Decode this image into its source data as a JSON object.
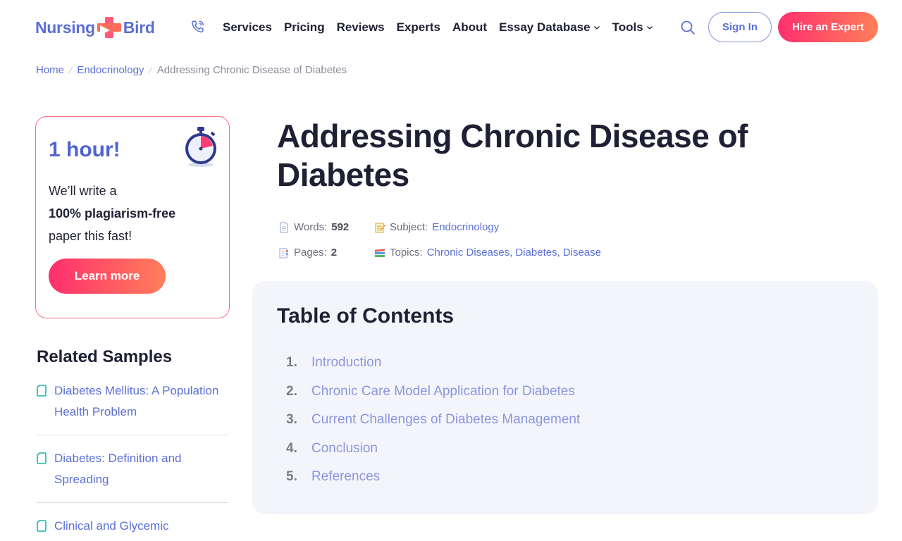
{
  "header": {
    "logo_left": "Nursing",
    "logo_right": "Bird",
    "nav": [
      {
        "label": "Services",
        "dropdown": false
      },
      {
        "label": "Pricing",
        "dropdown": false
      },
      {
        "label": "Reviews",
        "dropdown": false
      },
      {
        "label": "Experts",
        "dropdown": false
      },
      {
        "label": "About",
        "dropdown": false
      },
      {
        "label": "Essay Database",
        "dropdown": true
      },
      {
        "label": "Tools",
        "dropdown": true
      }
    ],
    "signin_label": "Sign In",
    "hire_label": "Hire an Expert",
    "icons": {
      "phone": "phone-icon",
      "search": "search-icon"
    },
    "colors": {
      "brand": "#5b6fd6",
      "accent_start": "#ff2f6e",
      "accent_end": "#ff7f5a"
    }
  },
  "breadcrumb": {
    "home": "Home",
    "category": "Endocrinology",
    "current": "Addressing Chronic Disease of Diabetes"
  },
  "promo": {
    "title": "1 hour!",
    "line1": "We’ll write a",
    "line2": "100% plagiarism-free",
    "line3": "paper this fast!",
    "button": "Learn more",
    "icon": "stopwatch-icon"
  },
  "related": {
    "title": "Related Samples",
    "items": [
      "Diabetes Mellitus: A Population Health Problem",
      "Diabetes: Definition and Spreading",
      "Clinical and Glycemic"
    ]
  },
  "article": {
    "title": "Addressing Chronic Disease of Diabetes",
    "meta": {
      "words_label": "Words:",
      "words_value": "592",
      "pages_label": "Pages:",
      "pages_value": "2",
      "subject_label": "Subject:",
      "subject_value": "Endocrinology",
      "topics_label": "Topics:",
      "topics": [
        "Chronic Diseases",
        "Diabetes",
        "Disease"
      ]
    }
  },
  "toc": {
    "title": "Table of Contents",
    "items": [
      {
        "num": "1.",
        "label": "Introduction"
      },
      {
        "num": "2.",
        "label": "Chronic Care Model Application for Diabetes"
      },
      {
        "num": "3.",
        "label": "Current Challenges of Diabetes Management"
      },
      {
        "num": "4.",
        "label": "Conclusion"
      },
      {
        "num": "5.",
        "label": "References"
      }
    ]
  }
}
